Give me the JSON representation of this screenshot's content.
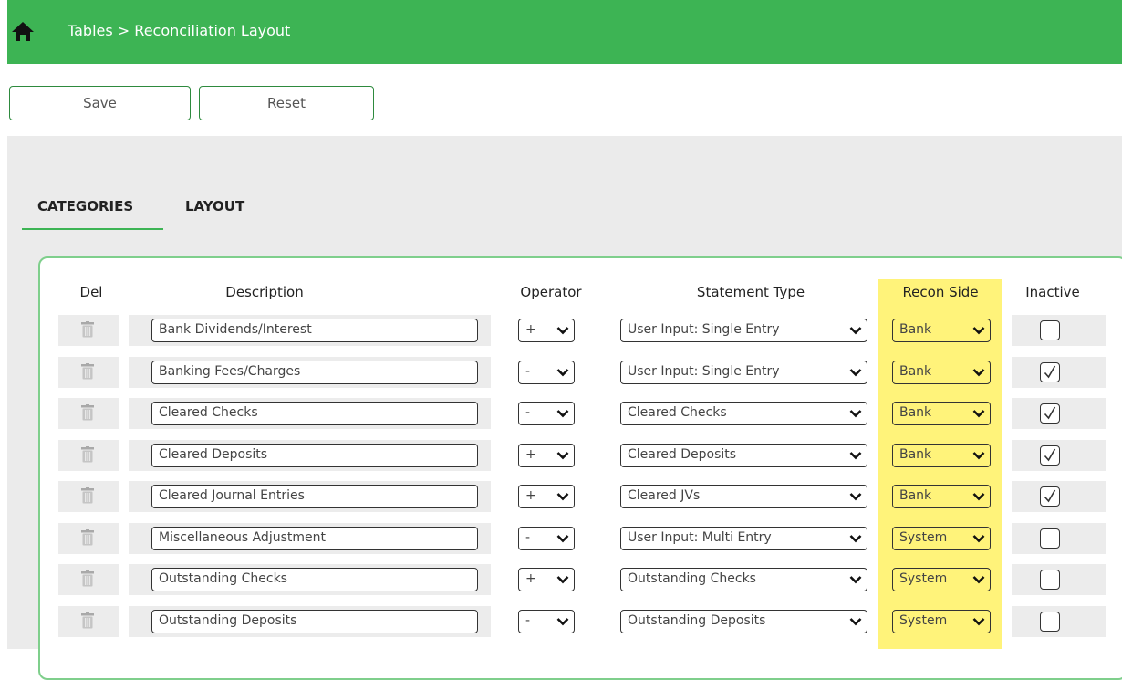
{
  "header": {
    "breadcrumb": "Tables > Reconciliation Layout",
    "home_icon": "home-icon"
  },
  "toolbar": {
    "save_label": "Save",
    "reset_label": "Reset"
  },
  "tabs": [
    {
      "label": "CATEGORIES",
      "active": true
    },
    {
      "label": "LAYOUT",
      "active": false
    }
  ],
  "columns": {
    "del": "Del",
    "description": "Description",
    "operator": "Operator",
    "statement_type": "Statement Type",
    "recon_side": "Recon Side",
    "inactive": "Inactive"
  },
  "rows": [
    {
      "description": "Bank Dividends/Interest",
      "operator": "+",
      "statement_type": "User Input: Single Entry",
      "recon_side": "Bank",
      "inactive": false
    },
    {
      "description": "Banking Fees/Charges",
      "operator": "-",
      "statement_type": "User Input: Single Entry",
      "recon_side": "Bank",
      "inactive": true
    },
    {
      "description": "Cleared Checks",
      "operator": "-",
      "statement_type": "Cleared Checks",
      "recon_side": "Bank",
      "inactive": true
    },
    {
      "description": "Cleared Deposits",
      "operator": "+",
      "statement_type": "Cleared Deposits",
      "recon_side": "Bank",
      "inactive": true
    },
    {
      "description": "Cleared Journal Entries",
      "operator": "+",
      "statement_type": "Cleared JVs",
      "recon_side": "Bank",
      "inactive": true
    },
    {
      "description": "Miscellaneous Adjustment",
      "operator": "-",
      "statement_type": "User Input: Multi Entry",
      "recon_side": "System",
      "inactive": false
    },
    {
      "description": "Outstanding Checks",
      "operator": "+",
      "statement_type": "Outstanding Checks",
      "recon_side": "System",
      "inactive": false
    },
    {
      "description": "Outstanding Deposits",
      "operator": "-",
      "statement_type": "Outstanding Deposits",
      "recon_side": "System",
      "inactive": false
    }
  ],
  "colors": {
    "header_green": "#3db454",
    "highlight_yellow": "#fff37a",
    "button_border": "#2e8a3e"
  }
}
